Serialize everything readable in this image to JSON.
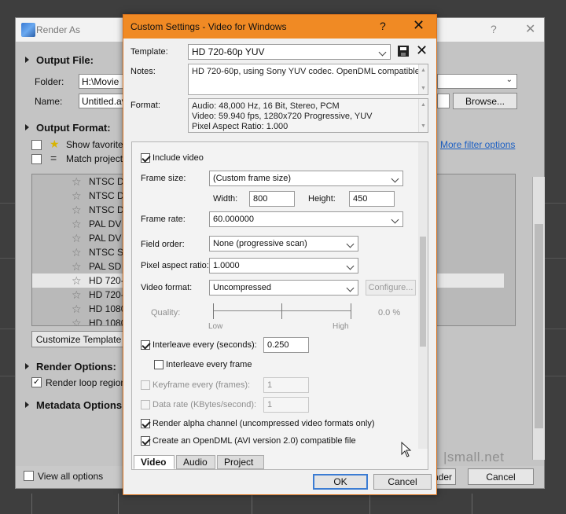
{
  "render_as": {
    "title": "Render As",
    "help_glyph": "?",
    "close_glyph": "✕",
    "output_file": {
      "section": "Output File:",
      "folder_label": "Folder:",
      "folder_value": "H:\\Movie",
      "name_label": "Name:",
      "name_value": "Untitled.av",
      "browse": "Browse..."
    },
    "output_format": {
      "section": "Output Format:",
      "show_favorites": "Show favorite",
      "match_project": "Match project",
      "more_filter": "More filter options",
      "items": [
        "NTSC DV",
        "NTSC DV",
        "NTSC DV",
        "PAL DV",
        "PAL DV",
        "NTSC SD",
        "PAL SD",
        "HD 720-",
        "HD 720-",
        "HD 1080",
        "HD 1080"
      ],
      "selected_index": 7,
      "customize": "Customize Template"
    },
    "render_options": {
      "section": "Render Options:",
      "render_loop": "Render loop region"
    },
    "metadata": {
      "section": "Metadata Options"
    },
    "view_all": "View all options",
    "render_button": "nder",
    "cancel": "Cancel"
  },
  "dialog": {
    "title": "Custom Settings - Video for Windows",
    "help_glyph": "?",
    "close_glyph": "✕",
    "template_label": "Template:",
    "template_value": "HD 720-60p YUV",
    "notes_label": "Notes:",
    "notes_value": "HD 720-60p, using Sony YUV codec. OpenDML compatible.",
    "format_label": "Format:",
    "format_lines": [
      "Audio: 48,000 Hz, 16 Bit, Stereo, PCM",
      "Video: 59.940 fps, 1280x720 Progressive, YUV",
      "Pixel Aspect Ratio: 1.000"
    ],
    "include_video": "Include video",
    "frame_size_label": "Frame size:",
    "frame_size_value": "(Custom frame size)",
    "width_label": "Width:",
    "width_value": "800",
    "height_label": "Height:",
    "height_value": "450",
    "frame_rate_label": "Frame rate:",
    "frame_rate_value": "60.000000",
    "field_order_label": "Field order:",
    "field_order_value": "None (progressive scan)",
    "par_label": "Pixel aspect ratio:",
    "par_value": "1.0000",
    "video_format_label": "Video format:",
    "video_format_value": "Uncompressed",
    "configure": "Configure...",
    "quality_label": "Quality:",
    "quality_low": "Low",
    "quality_high": "High",
    "quality_value": "0.0 %",
    "interleave_label": "Interleave every (seconds):",
    "interleave_value": "0.250",
    "interleave_frame": "Interleave every frame",
    "keyframe_label": "Keyframe every (frames):",
    "keyframe_value": "1",
    "datarate_label": "Data rate (KBytes/second):",
    "datarate_value": "1",
    "render_alpha": "Render alpha channel (uncompressed video formats only)",
    "opendml": "Create an OpenDML (AVI version 2.0) compatible file",
    "tabs": [
      "Video",
      "Audio",
      "Project"
    ],
    "ok": "OK",
    "cancel": "Cancel"
  },
  "watermark": "|small.net"
}
